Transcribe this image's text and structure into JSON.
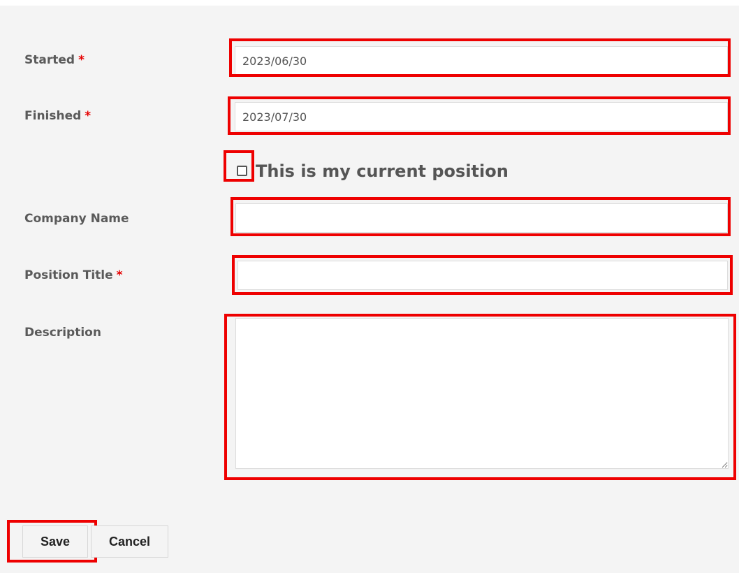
{
  "form": {
    "started": {
      "label": "Started",
      "required_mark": "*",
      "value": "2023/06/30"
    },
    "finished": {
      "label": "Finished",
      "required_mark": "*",
      "value": "2023/07/30"
    },
    "current_position": {
      "label": "This is my current position",
      "checked": false
    },
    "company_name": {
      "label": "Company Name",
      "value": ""
    },
    "position_title": {
      "label": "Position Title",
      "required_mark": "*",
      "value": ""
    },
    "description": {
      "label": "Description",
      "value": ""
    }
  },
  "buttons": {
    "save": "Save",
    "cancel": "Cancel"
  },
  "colors": {
    "highlight": "#ee0000",
    "required": "#e60000",
    "panel_background": "#f4f4f4"
  }
}
